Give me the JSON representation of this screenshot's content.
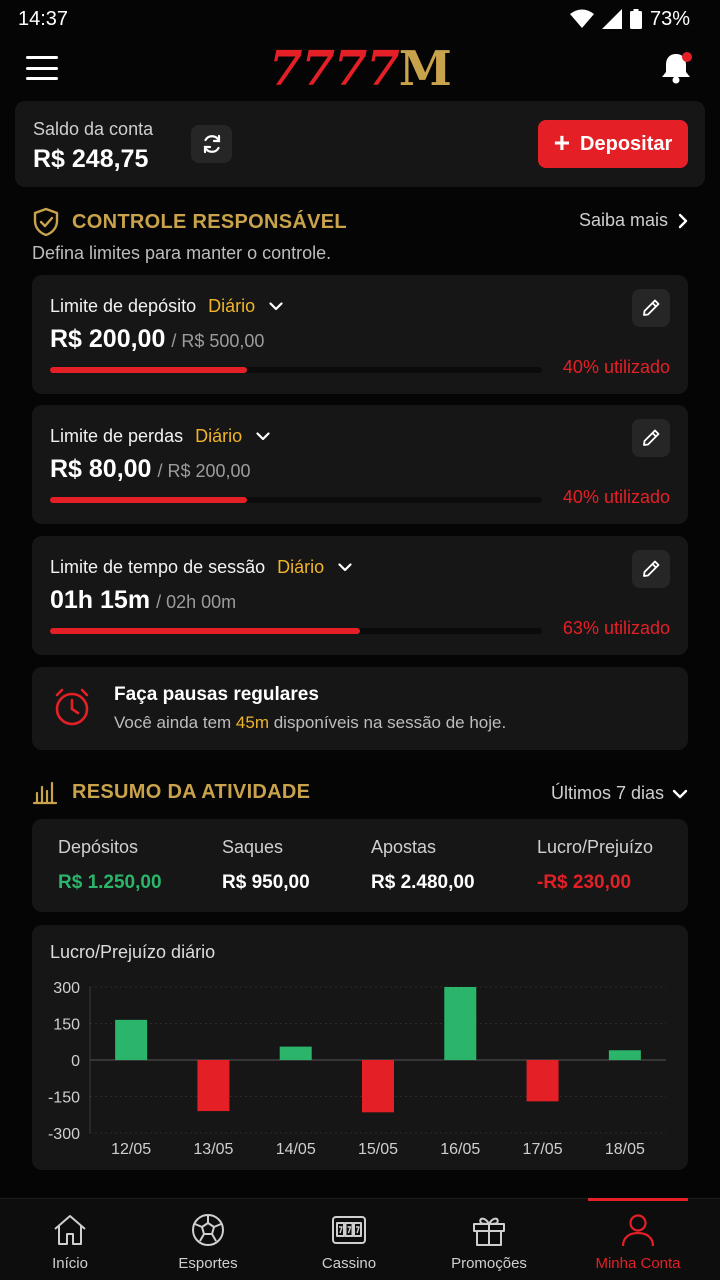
{
  "status_bar": {
    "time": "14:37",
    "battery": "73%"
  },
  "app": {
    "logo_numbers": "7777",
    "logo_letter": "M",
    "icons": {
      "menu": "hamburger-icon",
      "notifications": "bell-icon"
    }
  },
  "balance": {
    "label": "Saldo da conta",
    "value": "R$ 248,75",
    "deposit_label": "Depositar"
  },
  "responsible": {
    "title": "CONTROLE RESPONSÁVEL",
    "more_label": "Saiba mais",
    "subtitle": "Defina limites para manter o controle.",
    "limits": [
      {
        "label": "Limite de depósito",
        "period": "Diário",
        "current": "R$ 200,00",
        "max": "/ R$ 500,00",
        "percent": 40,
        "usage": "40% utilizado"
      },
      {
        "label": "Limite de perdas",
        "period": "Diário",
        "current": "R$ 80,00",
        "max": "/ R$ 200,00",
        "percent": 40,
        "usage": "40% utilizado"
      },
      {
        "label": "Limite de tempo de sessão",
        "period": "Diário",
        "current": "01h 15m",
        "max": "/ 02h 00m",
        "percent": 63,
        "usage": "63% utilizado"
      }
    ],
    "pause": {
      "title": "Faça pausas regulares",
      "text_before": "Você ainda tem ",
      "highlight": "45m",
      "text_after": " disponíveis na sessão de hoje."
    }
  },
  "activity": {
    "title": "RESUMO DA ATIVIDADE",
    "period": "Últimos 7 dias",
    "stats": [
      {
        "label": "Depósitos",
        "value": "R$ 1.250,00",
        "color": "#2bb56a"
      },
      {
        "label": "Saques",
        "value": "R$ 950,00",
        "color": "#ffffff"
      },
      {
        "label": "Apostas",
        "value": "R$ 2.480,00",
        "color": "#ffffff"
      },
      {
        "label": "Lucro/Prejuízo",
        "value": "-R$ 230,00",
        "color": "#e42026"
      }
    ]
  },
  "chart_data": {
    "type": "bar",
    "title": "Lucro/Prejuízo diário",
    "categories": [
      "12/05",
      "13/05",
      "14/05",
      "15/05",
      "16/05",
      "17/05",
      "18/05"
    ],
    "values": [
      165,
      -210,
      55,
      -215,
      300,
      -170,
      40
    ],
    "yticks": [
      300,
      150,
      0,
      -150,
      -300
    ],
    "ylim": [
      -300,
      300
    ],
    "positive_color": "#2bb56a",
    "negative_color": "#e42026",
    "grid": true
  },
  "nav": {
    "items": [
      {
        "label": "Início",
        "icon": "home-icon"
      },
      {
        "label": "Esportes",
        "icon": "soccer-ball-icon"
      },
      {
        "label": "Cassino",
        "icon": "slot-machine-icon"
      },
      {
        "label": "Promoções",
        "icon": "gift-icon"
      },
      {
        "label": "Minha Conta",
        "icon": "user-icon"
      }
    ],
    "active_index": 4
  }
}
